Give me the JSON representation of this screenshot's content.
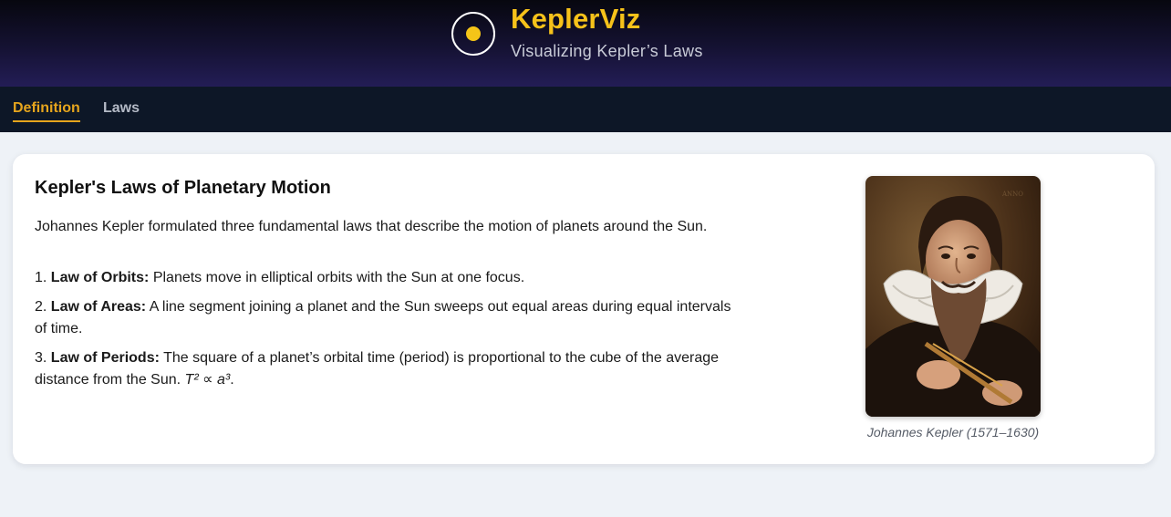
{
  "header": {
    "logo_icon": "orbit-sun-icon",
    "title": "KeplerViz",
    "subtitle": "Visualizing Kepler’s Laws",
    "accent_color": "#f6c21a"
  },
  "tabs": [
    {
      "label": "Definition",
      "active": true
    },
    {
      "label": "Laws",
      "active": false
    }
  ],
  "content": {
    "title": "Kepler's Laws of Planetary Motion",
    "intro": "Johannes Kepler formulated three fundamental laws that describe the motion of planets around the Sun.",
    "laws": [
      {
        "number": "1.",
        "label": "Law of Orbits:",
        "text": "Planets move in elliptical orbits with the Sun at one focus."
      },
      {
        "number": "2.",
        "label": "Law of Areas:",
        "text": "A line segment joining a planet and the Sun sweeps out equal areas during equal intervals of time."
      },
      {
        "number": "3.",
        "label": "Law of Periods:",
        "text": "The square of a planet’s orbital time (period) is proportional to the cube of the average distance from the Sun.",
        "formula": "T² ∝ a³",
        "formula_end": "."
      }
    ],
    "portrait": {
      "caption": "Johannes Kepler (1571–1630)"
    }
  }
}
